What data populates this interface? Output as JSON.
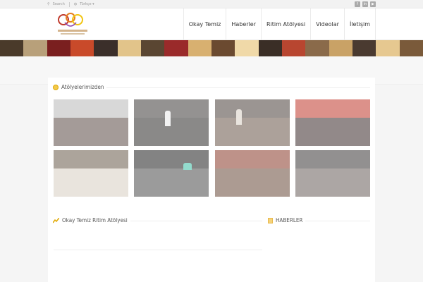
{
  "topbar": {
    "search_label": "Search",
    "language_label": "Türkçe",
    "social": [
      "f",
      "in",
      "▶"
    ]
  },
  "nav": {
    "items": [
      "Okay Temiz",
      "Haberler",
      "Ritim Atölyesi",
      "Videolar",
      "İletişim"
    ]
  },
  "sections": {
    "workshops_title": "Atölyelerimizden",
    "rhythm_title": "Okay Temiz Ritim Atölyesi",
    "news_title": "HABERLER"
  },
  "colors": {
    "accent": "#f2c94c",
    "nav_text": "#333333"
  }
}
